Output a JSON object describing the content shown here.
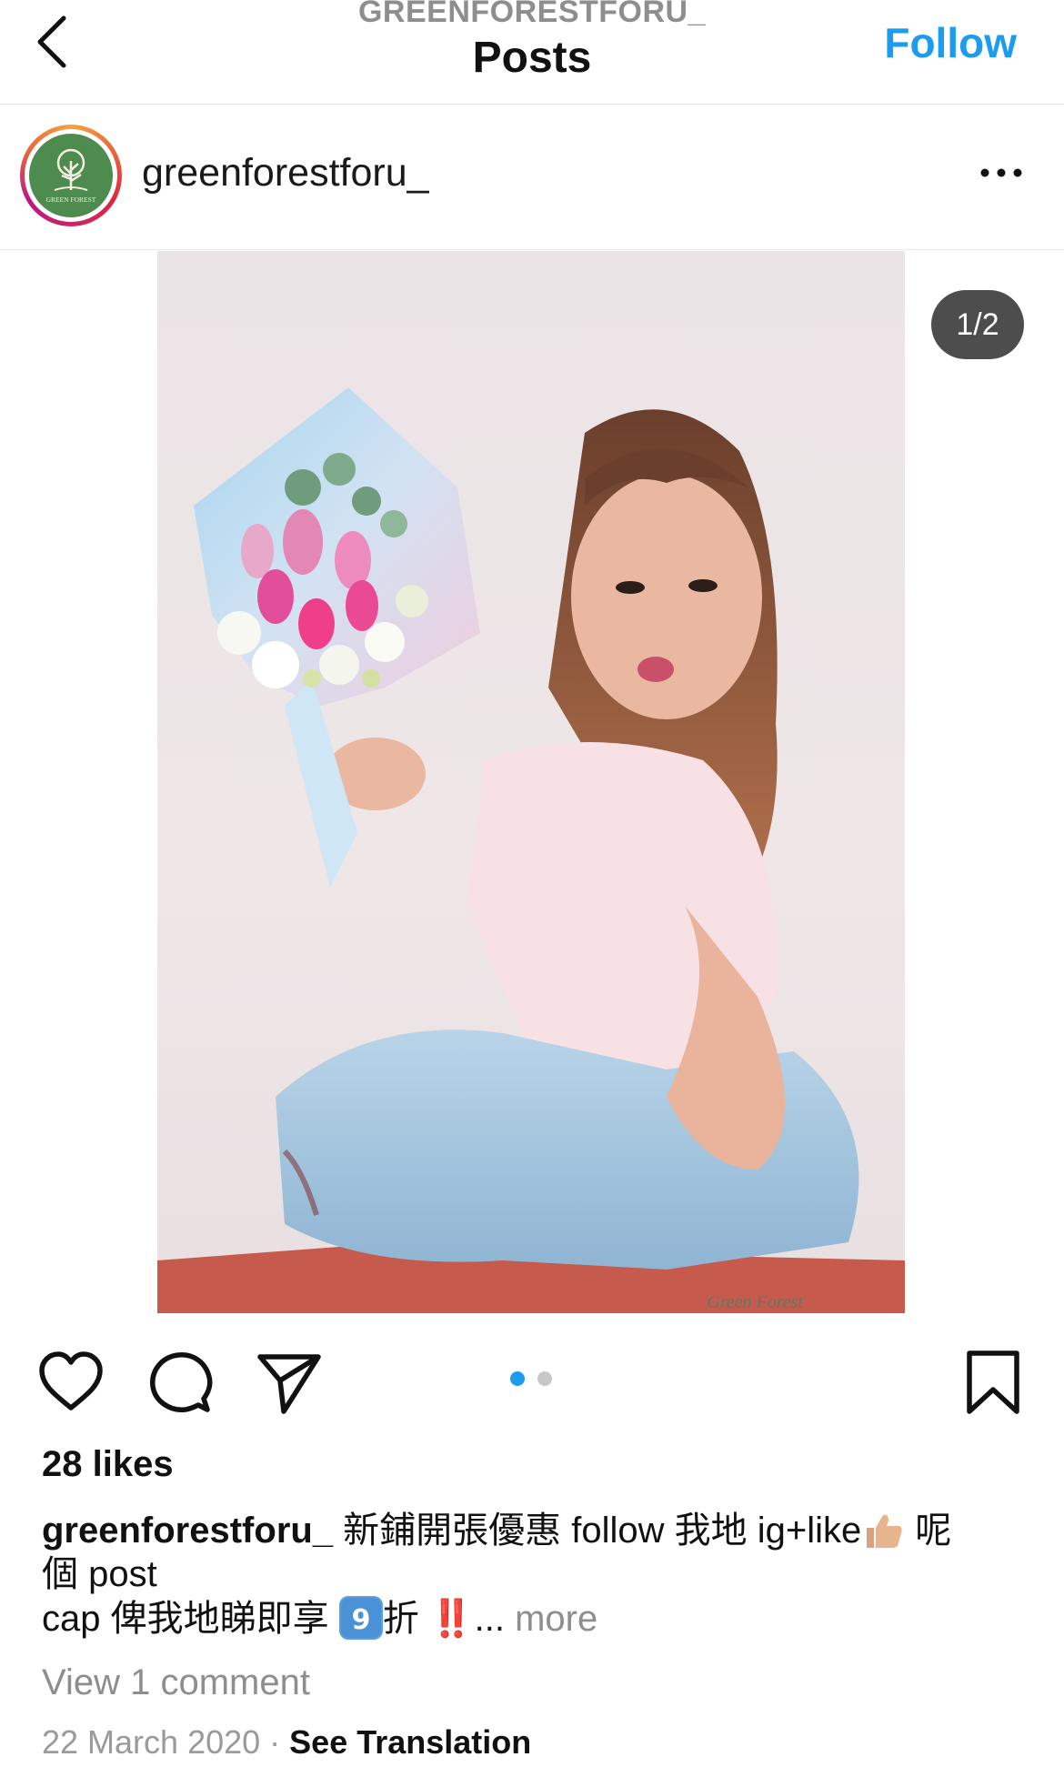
{
  "nav": {
    "account_name": "GREENFORESTFORU_",
    "title": "Posts",
    "follow_label": "Follow"
  },
  "post": {
    "username": "greenforestforu_",
    "avatar_text": "GREEN FOREST",
    "image_counter": "1/2",
    "watermark": "Green Forest",
    "carousel_dots": 2,
    "active_dot": 0
  },
  "actions": {
    "like_icon": "heart-icon",
    "comment_icon": "comment-bubble-icon",
    "share_icon": "paper-plane-icon",
    "save_icon": "bookmark-icon"
  },
  "meta": {
    "likes": "28 likes",
    "caption_user": "greenforestforu_",
    "caption_line1": " 新鋪開張優惠 follow 我地 ig+like",
    "caption_after_thumb": " 呢",
    "caption_line2": "個 post",
    "caption_line3": "cap 俾我地睇即享 ",
    "caption_nine": "9",
    "caption_zhe": "折 ",
    "caption_bang": "‼️",
    "caption_ellipsis": "... ",
    "more_label": "more",
    "view_comments": "View 1 comment",
    "date": "22 March 2020",
    "separator": " · ",
    "see_translation": "See Translation"
  },
  "colors": {
    "accent": "#1c9cef",
    "muted": "#8e8e8e",
    "counter_bg": "#262626"
  }
}
